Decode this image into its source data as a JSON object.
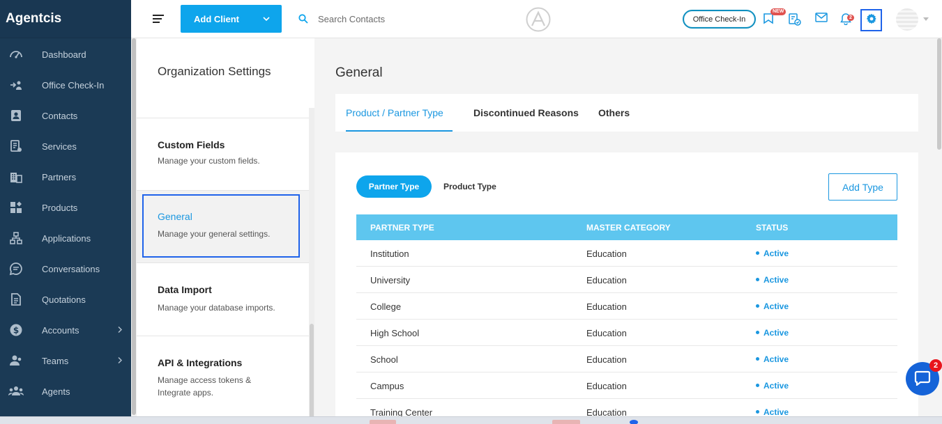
{
  "app": {
    "brand": "Agentcis"
  },
  "sidebar": {
    "items": [
      {
        "label": "Dashboard",
        "icon": "dashboard-icon"
      },
      {
        "label": "Office Check-In",
        "icon": "checkin-icon"
      },
      {
        "label": "Contacts",
        "icon": "contacts-icon"
      },
      {
        "label": "Services",
        "icon": "services-icon"
      },
      {
        "label": "Partners",
        "icon": "partners-icon"
      },
      {
        "label": "Products",
        "icon": "products-icon"
      },
      {
        "label": "Applications",
        "icon": "applications-icon"
      },
      {
        "label": "Conversations",
        "icon": "conversations-icon"
      },
      {
        "label": "Quotations",
        "icon": "quotations-icon"
      },
      {
        "label": "Accounts",
        "icon": "accounts-icon",
        "has_submenu": true
      },
      {
        "label": "Teams",
        "icon": "teams-icon",
        "has_submenu": true
      },
      {
        "label": "Agents",
        "icon": "agents-icon"
      }
    ]
  },
  "topbar": {
    "add_client_label": "Add Client",
    "search_placeholder": "Search Contacts",
    "office_checkin_label": "Office Check-In",
    "new_badge": "NEW",
    "notification_count": "2"
  },
  "settings_panel": {
    "title": "Organization Settings",
    "items": [
      {
        "title": "Custom Fields",
        "desc": "Manage your custom fields."
      },
      {
        "title": "General",
        "desc": "Manage your general settings.",
        "active": true
      },
      {
        "title": "Data Import",
        "desc": "Manage your database imports."
      },
      {
        "title": "API & Integrations",
        "desc": "Manage access tokens & Integrate apps."
      }
    ]
  },
  "main": {
    "title": "General",
    "tabs": [
      {
        "label": "Product / Partner Type",
        "active": true
      },
      {
        "label": "Discontinued Reasons"
      },
      {
        "label": "Others"
      }
    ],
    "type_toggle": {
      "partner": "Partner Type",
      "product": "Product Type"
    },
    "add_type_label": "Add Type",
    "table": {
      "headers": [
        "PARTNER TYPE",
        "MASTER CATEGORY",
        "STATUS"
      ],
      "rows": [
        {
          "type": "Institution",
          "category": "Education",
          "status": "Active"
        },
        {
          "type": "University",
          "category": "Education",
          "status": "Active"
        },
        {
          "type": "College",
          "category": "Education",
          "status": "Active"
        },
        {
          "type": "High School",
          "category": "Education",
          "status": "Active"
        },
        {
          "type": "School",
          "category": "Education",
          "status": "Active"
        },
        {
          "type": "Campus",
          "category": "Education",
          "status": "Active"
        },
        {
          "type": "Training Center",
          "category": "Education",
          "status": "Active"
        }
      ]
    }
  },
  "chat": {
    "badge": "2"
  },
  "colors": {
    "sidebar": "#1b3a55",
    "accent": "#0ea5ec",
    "table_header": "#5ec6ef",
    "highlight_frame": "#1f63ea"
  }
}
